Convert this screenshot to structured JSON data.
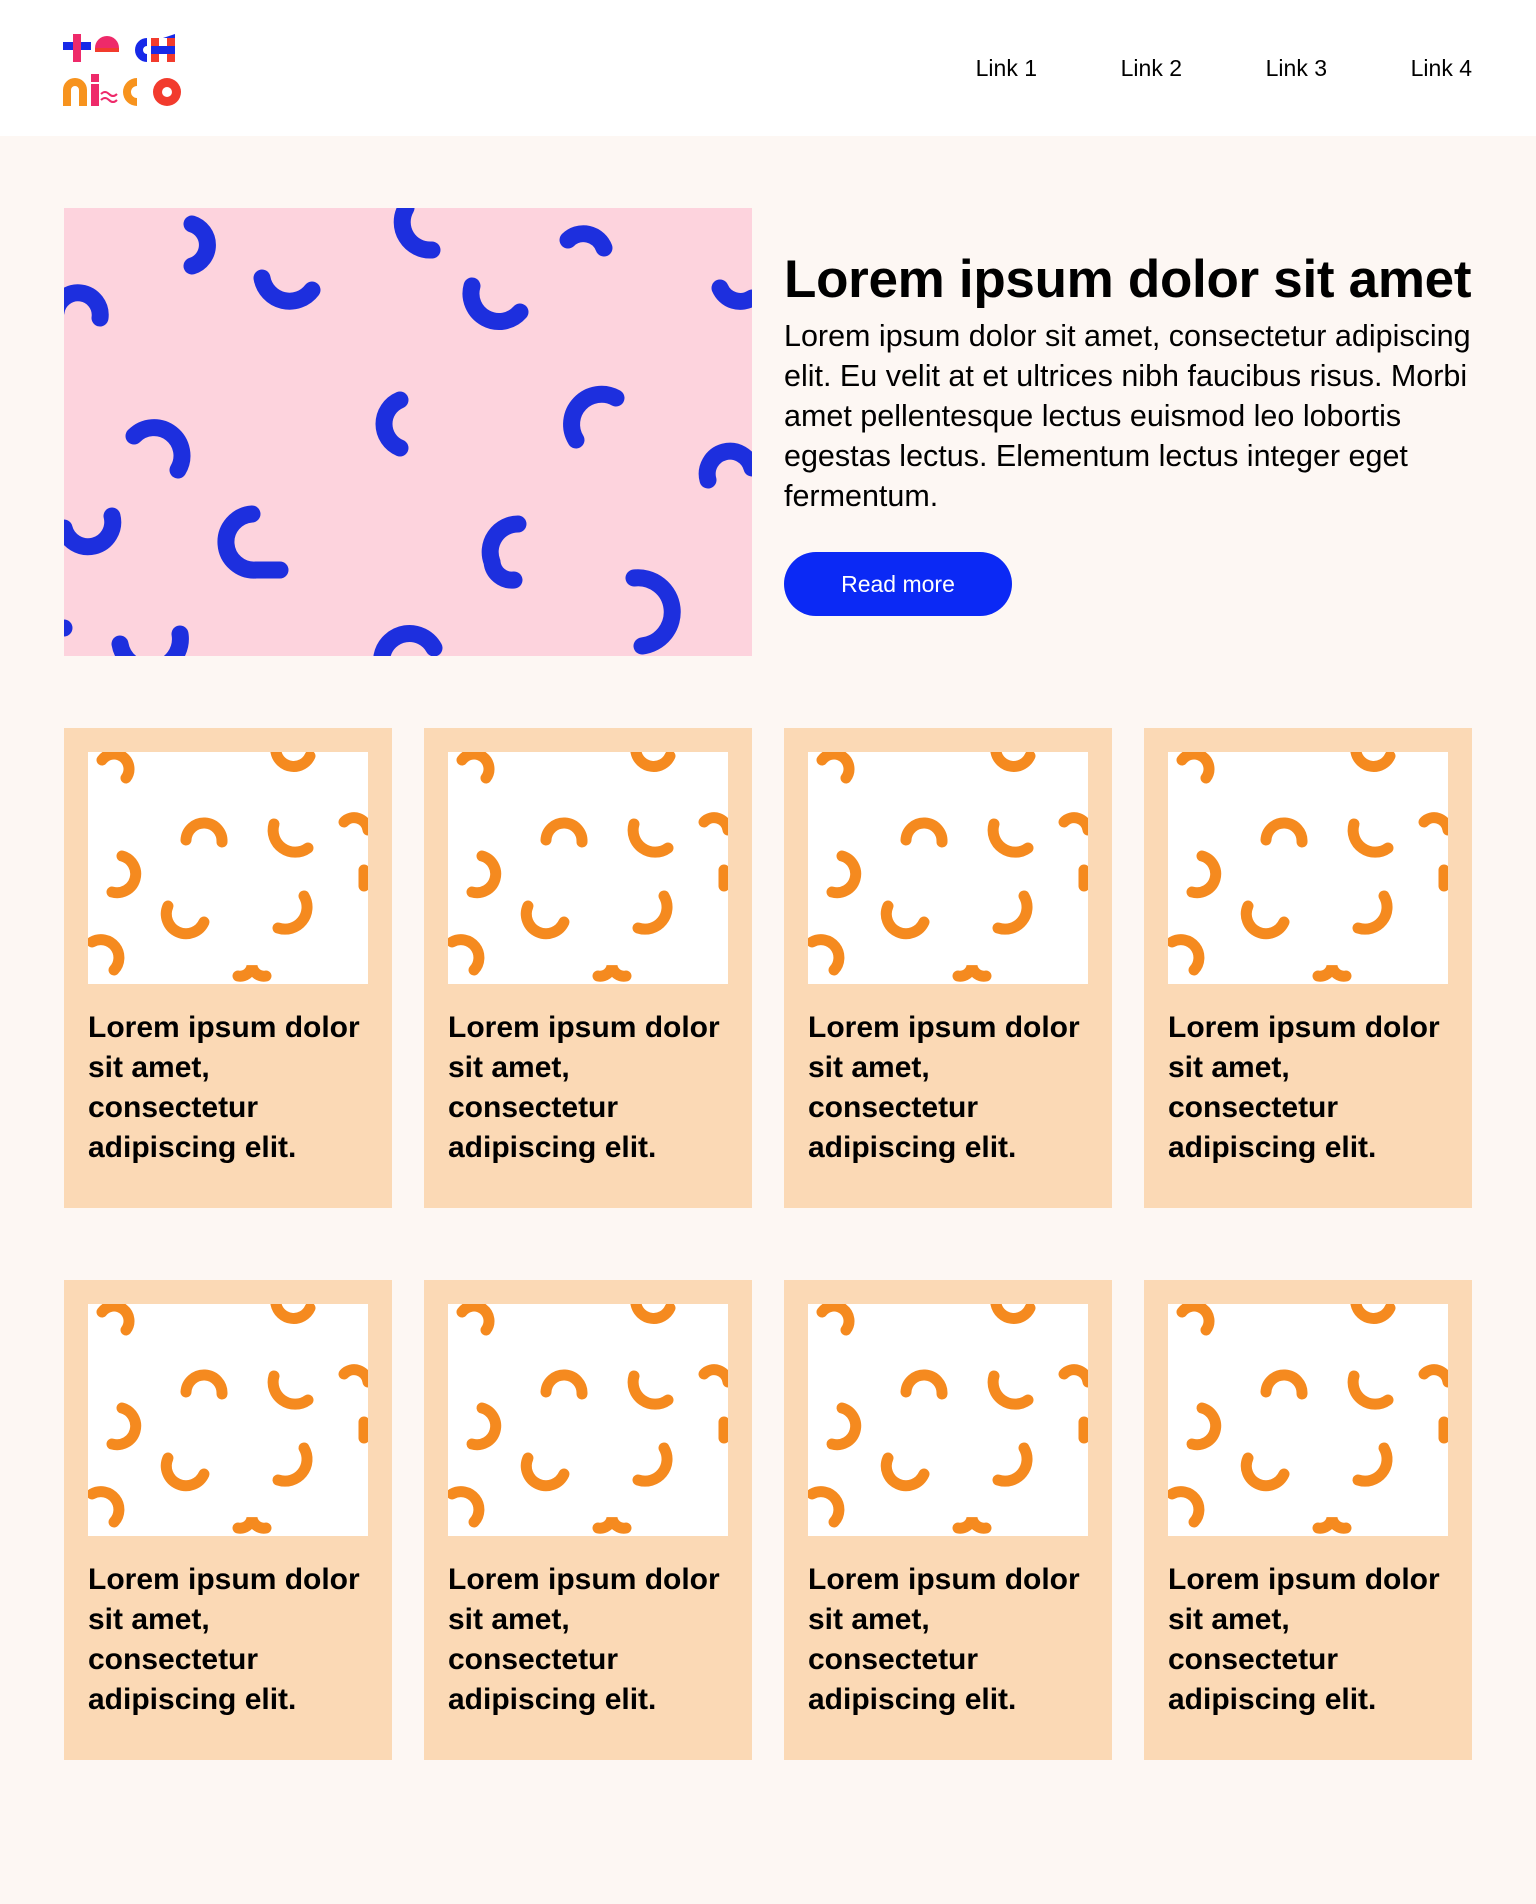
{
  "brand": {
    "logo_alt": "TECH NICO",
    "colors": {
      "blue": "#1729e8",
      "pink": "#ee2a6a",
      "orange": "#f7931e",
      "red": "#f23b2d"
    }
  },
  "nav": {
    "links": [
      {
        "label": "Link 1"
      },
      {
        "label": "Link 2"
      },
      {
        "label": "Link 3"
      },
      {
        "label": "Link 4"
      }
    ]
  },
  "hero": {
    "title": "Lorem ipsum dolor sit amet",
    "description": "Lorem ipsum dolor sit amet, consectetur adipiscing elit. Eu velit at et ultrices nibh faucibus risus. Morbi amet pellentesque lectus euismod leo lobortis egestas lectus. Elementum lectus integer eget fermentum.",
    "button_label": "Read more",
    "image_background": "#fdd3dd",
    "pattern_color": "#1d2fde"
  },
  "cards": {
    "background": "#fbd9b5",
    "pattern_color": "#f58a1f",
    "items": [
      {
        "text": "Lorem ipsum dolor sit amet, consectetur adipiscing elit."
      },
      {
        "text": "Lorem ipsum dolor sit amet, consectetur adipiscing elit."
      },
      {
        "text": "Lorem ipsum dolor sit amet, consectetur adipiscing elit."
      },
      {
        "text": "Lorem ipsum dolor sit amet, consectetur adipiscing elit."
      },
      {
        "text": "Lorem ipsum dolor sit amet, consectetur adipiscing elit."
      },
      {
        "text": "Lorem ipsum dolor sit amet, consectetur adipiscing elit."
      },
      {
        "text": "Lorem ipsum dolor sit amet, consectetur adipiscing elit."
      },
      {
        "text": "Lorem ipsum dolor sit amet, consectetur adipiscing elit."
      }
    ]
  }
}
